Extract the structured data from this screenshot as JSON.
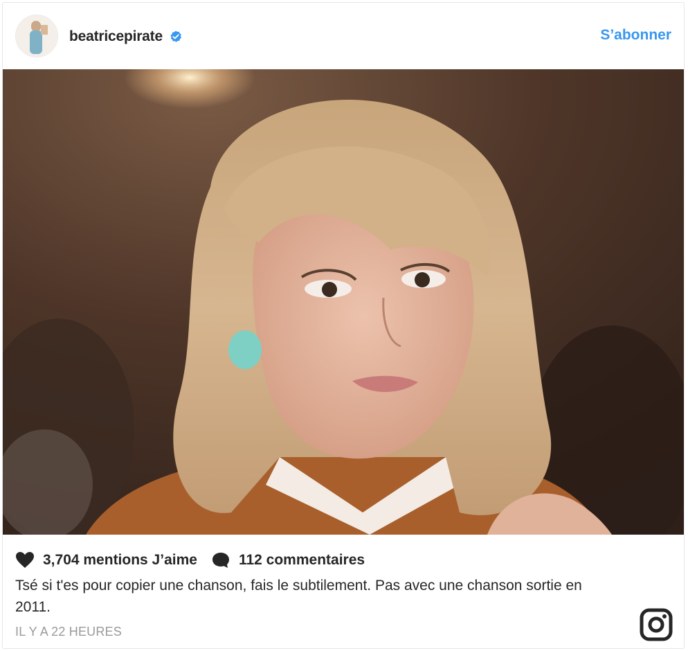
{
  "post": {
    "username": "beatricepirate",
    "verified_icon": "verified-badge-icon",
    "follow_label": "S’abonner",
    "likes_text": "3,704 mentions J’aime",
    "comments_text": "112 commentaires",
    "caption": "Tsé si t'es pour copier une chanson, fais le subtilement. Pas avec une chanson sortie en 2011.",
    "timestamp": "IL Y A 22 HEURES",
    "photo_subject": "woman-photo",
    "icons": {
      "like": "heart-icon",
      "comment": "comment-icon",
      "brand": "instagram-icon"
    }
  },
  "colors": {
    "accent": "#3897f0",
    "text": "#262626",
    "muted": "#999999",
    "border": "#e6e6e6"
  }
}
